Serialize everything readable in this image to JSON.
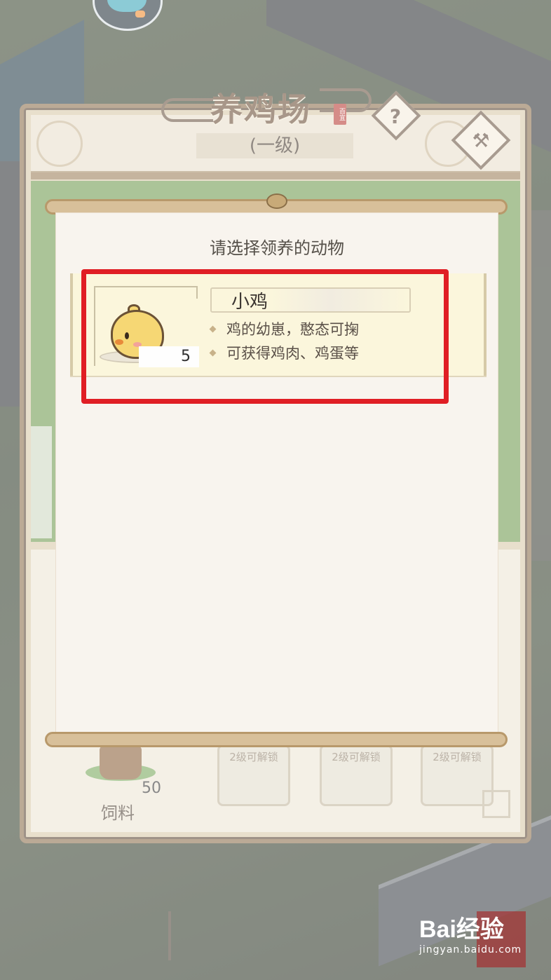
{
  "building": {
    "title": "养鸡场",
    "seal": "百宜",
    "level": "(一级)",
    "help_icon": "?"
  },
  "slots": [
    {
      "label": "饲料",
      "count": "50"
    },
    {
      "lock": "2级可解锁"
    },
    {
      "lock": "2级可解锁"
    },
    {
      "lock": "2级可解锁"
    }
  ],
  "dialog": {
    "prompt": "请选择领养的动物",
    "animals": [
      {
        "name": "小鸡",
        "count": "5",
        "desc": [
          "鸡的幼崽，憨态可掬",
          "可获得鸡肉、鸡蛋等"
        ]
      }
    ]
  },
  "watermark": {
    "brand": "Bai经验",
    "url": "jingyan.baidu.com"
  },
  "colors": {
    "highlight": "#e01e24",
    "panel_border": "#8a6d4b",
    "card_bg": "#fbf6dc"
  }
}
